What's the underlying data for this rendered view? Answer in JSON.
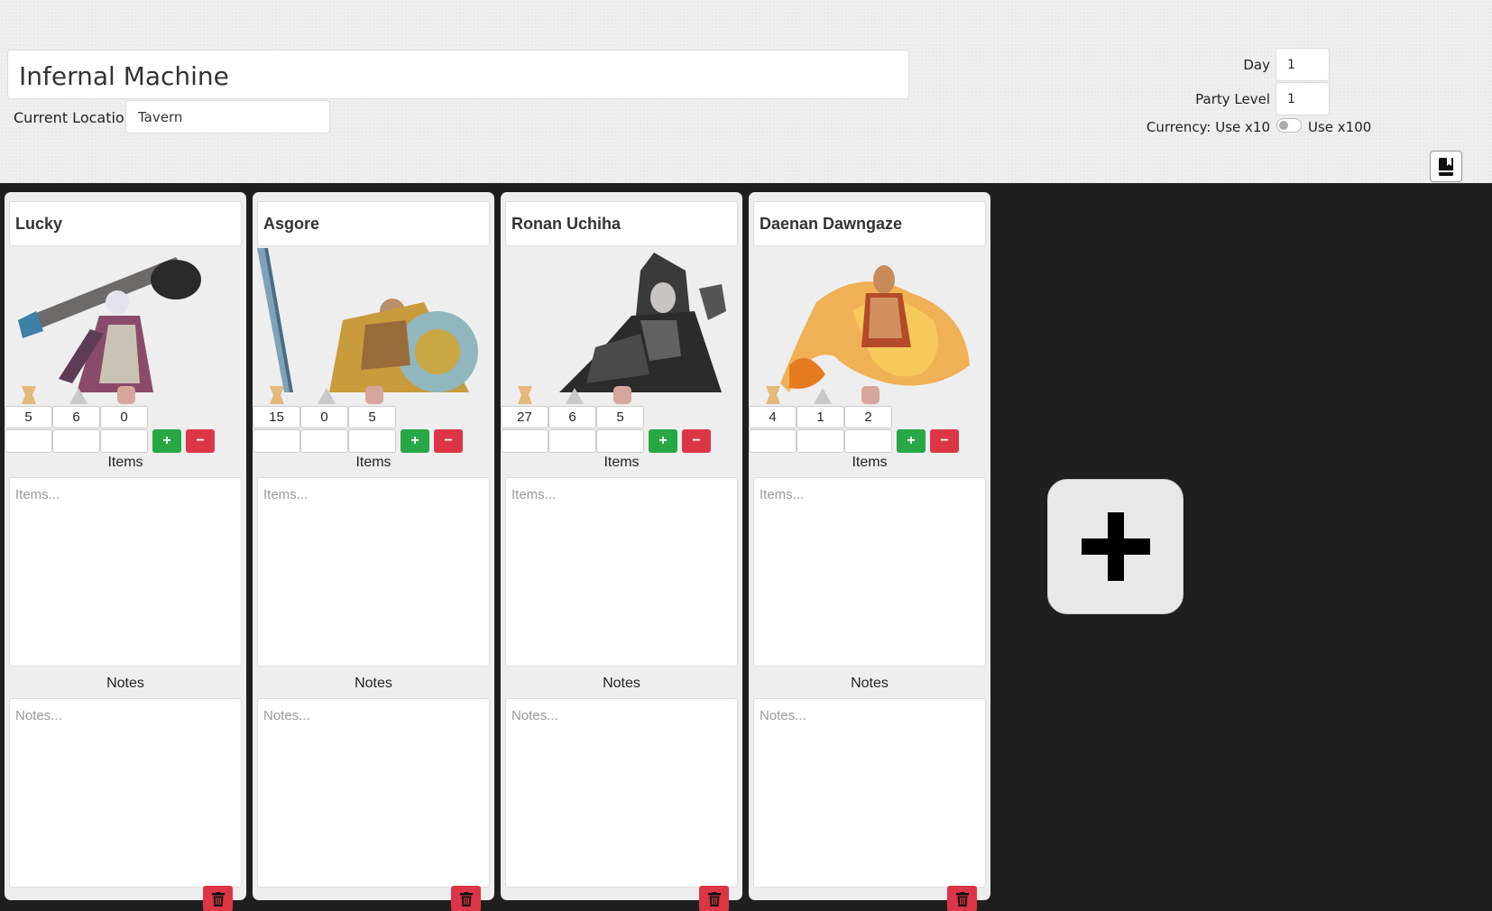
{
  "header": {
    "campaign_name": "Infernal Machine",
    "location_label": "Current Location",
    "location_value": "Tavern",
    "day_label": "Day",
    "day_value": "1",
    "party_level_label": "Party Level",
    "party_level_value": "1",
    "currency_label": "Currency: Use x10",
    "currency_alt_label": "Use x100"
  },
  "cards": [
    {
      "name": "Lucky",
      "gold": "5",
      "silver": "6",
      "copper": "0",
      "items_label": "Items",
      "items_placeholder": "Items...",
      "notes_label": "Notes",
      "notes_placeholder": "Notes...",
      "plus": "+",
      "minus": "−"
    },
    {
      "name": "Asgore",
      "gold": "15",
      "silver": "0",
      "copper": "5",
      "items_label": "Items",
      "items_placeholder": "Items...",
      "notes_label": "Notes",
      "notes_placeholder": "Notes...",
      "plus": "+",
      "minus": "−"
    },
    {
      "name": "Ronan Uchiha",
      "gold": "27",
      "silver": "6",
      "copper": "5",
      "items_label": "Items",
      "items_placeholder": "Items...",
      "notes_label": "Notes",
      "notes_placeholder": "Notes...",
      "plus": "+",
      "minus": "−"
    },
    {
      "name": "Daenan Dawngaze",
      "gold": "4",
      "silver": "1",
      "copper": "2",
      "items_label": "Items",
      "items_placeholder": "Items...",
      "notes_label": "Notes",
      "notes_placeholder": "Notes...",
      "plus": "+",
      "minus": "−"
    }
  ],
  "icons": {
    "gold": "gold-coin-icon",
    "silver": "silver-coin-icon",
    "copper": "copper-coin-icon",
    "journal": "journal-bookmark-icon",
    "trash": "trash-icon",
    "add": "plus-icon"
  },
  "colors": {
    "success": "#28a745",
    "danger": "#dc3545",
    "board": "#1f1f1f",
    "header": "#efefef"
  }
}
